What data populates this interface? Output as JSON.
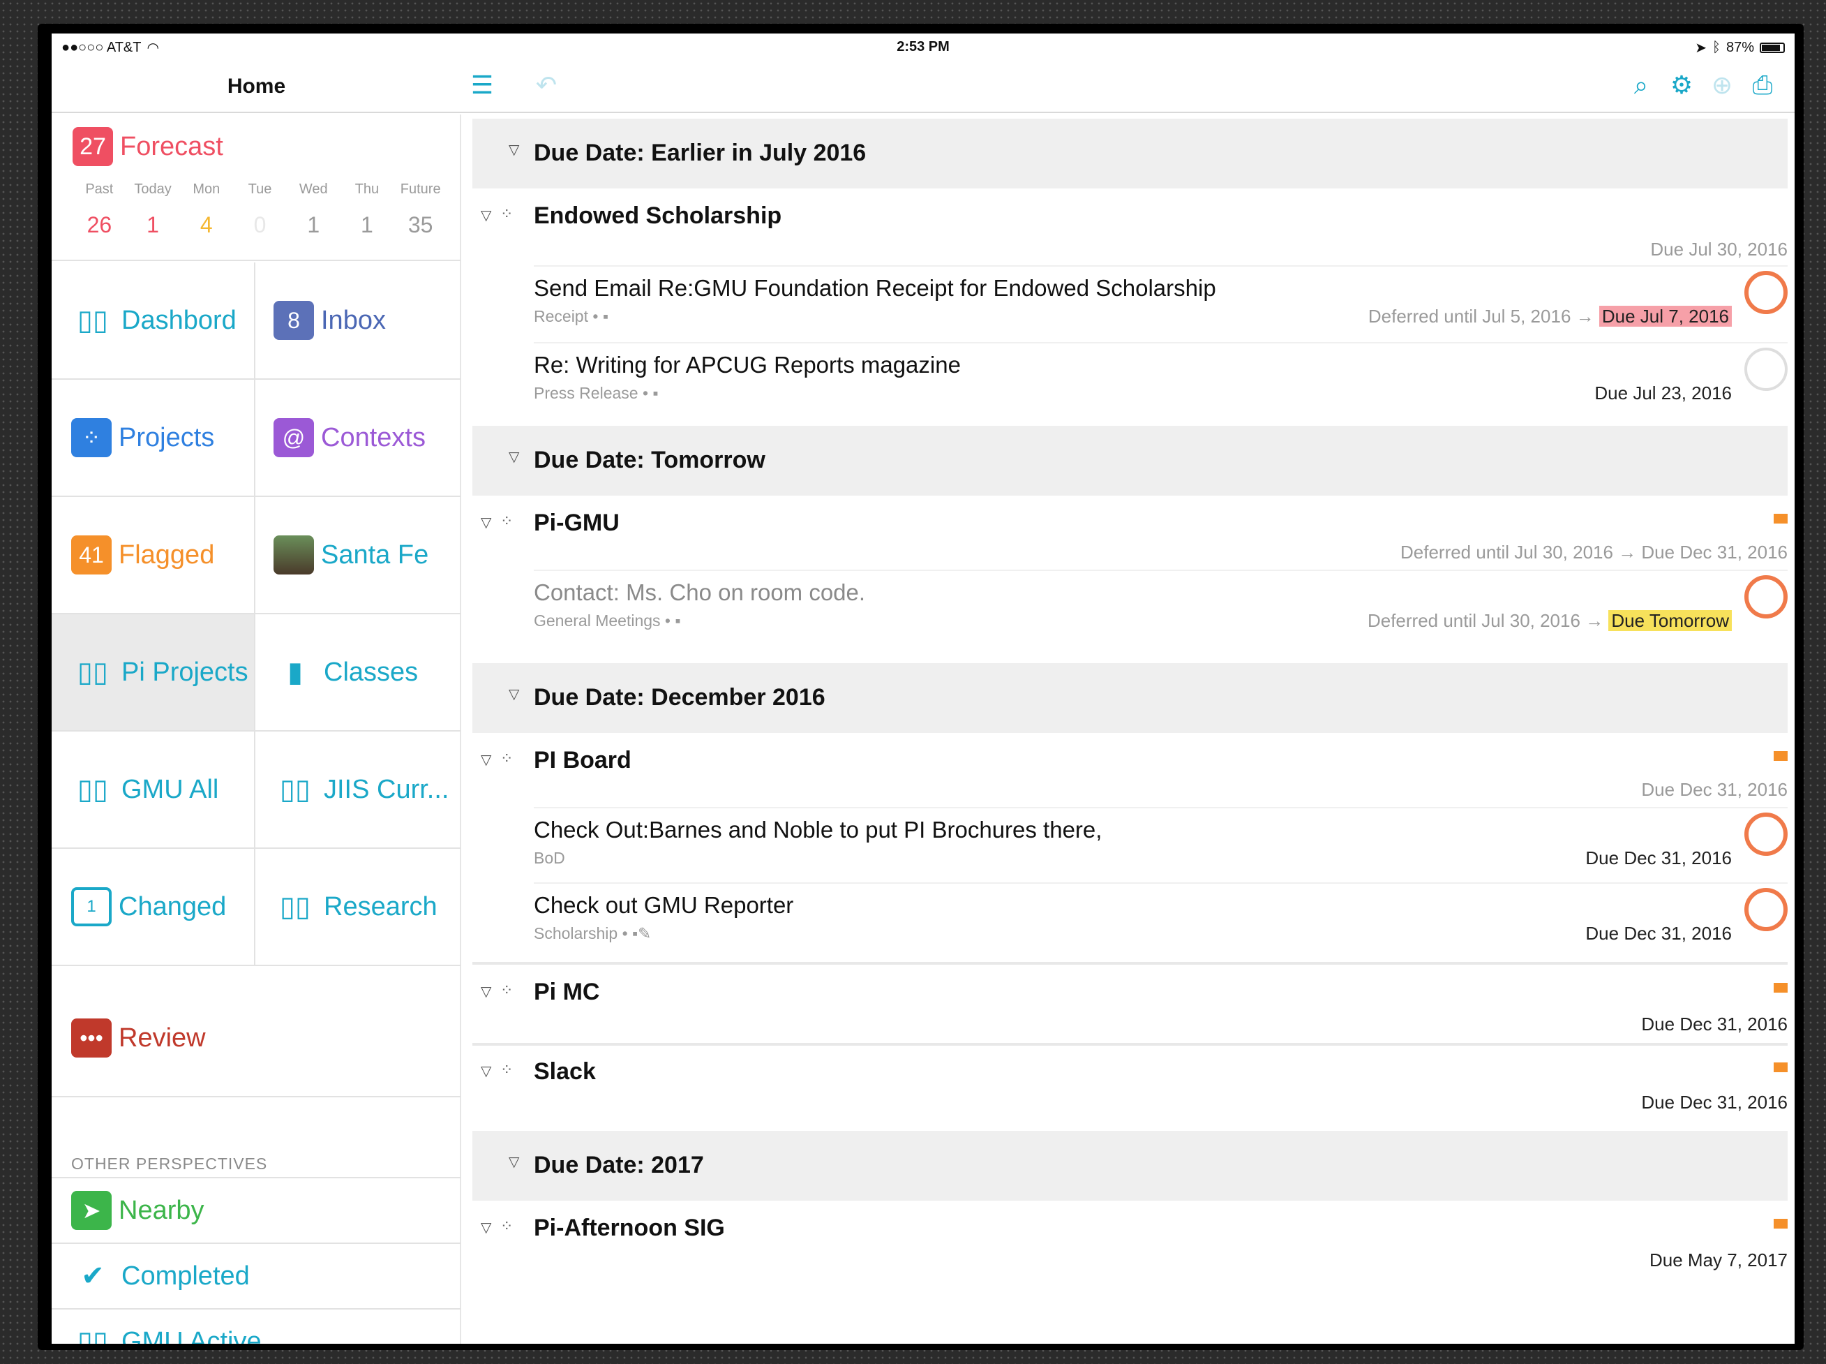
{
  "status": {
    "carrier": "●●○○○ AT&T",
    "wifi": "wifi-icon",
    "time": "2:53 PM",
    "battery": "87%"
  },
  "sidebar_header": {
    "title": "Home"
  },
  "forecast": {
    "badge": "27",
    "label": "Forecast",
    "days": [
      {
        "day": "Past",
        "count": "26",
        "color": "#ef4f62"
      },
      {
        "day": "Today",
        "count": "1",
        "color": "#ef4f62"
      },
      {
        "day": "Mon",
        "count": "4",
        "color": "#f5b731"
      },
      {
        "day": "Tue",
        "count": "0",
        "color": "#e8e8e8"
      },
      {
        "day": "Wed",
        "count": "1",
        "color": "#9a9a9a"
      },
      {
        "day": "Thu",
        "count": "1",
        "color": "#9a9a9a"
      },
      {
        "day": "Future",
        "count": "35",
        "color": "#9a9a9a"
      }
    ]
  },
  "perspectives": {
    "dashbord": "Dashbord",
    "inbox_badge": "8",
    "inbox": "Inbox",
    "projects": "Projects",
    "contexts": "Contexts",
    "flagged_badge": "41",
    "flagged": "Flagged",
    "santafe": "Santa Fe",
    "pi_projects": "Pi Projects",
    "classes": "Classes",
    "gmu_all": "GMU All",
    "jiis": "JIIS Curr...",
    "changed": "Changed",
    "changed_badge": "1",
    "research": "Research",
    "review": "Review"
  },
  "other": {
    "title": "OTHER PERSPECTIVES",
    "nearby": "Nearby",
    "completed": "Completed",
    "gmu_active": "GMU Active"
  },
  "sections": {
    "s1": "Due Date: Earlier in July 2016",
    "s2": "Due Date: Tomorrow",
    "s3": "Due Date: December 2016",
    "s4": "Due Date: 2017"
  },
  "projects": {
    "endowed": {
      "name": "Endowed Scholarship",
      "due": "Due Jul 30, 2016"
    },
    "pigmu": {
      "name": "Pi-GMU",
      "due": "Deferred until Jul 30, 2016 → Due Dec 31, 2016"
    },
    "piboard": {
      "name": "PI Board",
      "due": "Due Dec 31, 2016"
    },
    "pimc": {
      "name": "Pi MC",
      "due": "Due Dec 31, 2016"
    },
    "slack": {
      "name": "Slack",
      "due": "Due Dec 31, 2016"
    },
    "pisig": {
      "name": "Pi-Afternoon SIG",
      "due": "Due May 7, 2017"
    }
  },
  "tasks": {
    "t1": {
      "title": "Send Email Re:GMU Foundation Receipt for Endowed Scholarship",
      "context": "Receipt • ▪",
      "defer": "Deferred until Jul 5, 2016 →",
      "due": "Due Jul 7, 2016"
    },
    "t2": {
      "title": "Re: Writing for APCUG Reports magazine",
      "context": "Press Release • ▪",
      "due": "Due Jul 23, 2016"
    },
    "t3": {
      "title": "Contact:  Ms.  Cho on room code.",
      "context": "General Meetings • ▪",
      "defer": "Deferred until Jul 30, 2016 →",
      "due": "Due Tomorrow"
    },
    "t4": {
      "title": "Check Out:Barnes and Noble to put PI Brochures there,",
      "context": "BoD",
      "due": "Due Dec 31, 2016"
    },
    "t5": {
      "title": "Check out GMU Reporter",
      "context": "Scholarship • ▪✎",
      "due": "Due Dec 31, 2016"
    }
  },
  "colors": {
    "accent": "#1aa8c8",
    "forecast": "#ef4f62",
    "flagged": "#f5902a",
    "review": "#c0392b",
    "contexts": "#9b59d6",
    "nearby": "#3cb54a"
  }
}
